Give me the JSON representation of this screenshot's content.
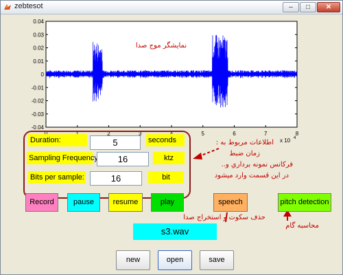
{
  "window": {
    "title": "zebtesot"
  },
  "plot": {
    "title": "نمایشگر موج صدا",
    "xticks": [
      "0",
      "1",
      "2",
      "3",
      "4",
      "5",
      "6",
      "7",
      "8"
    ],
    "yticks": [
      "0.04",
      "0.03",
      "0.02",
      "0.01",
      "0",
      "-0.01",
      "-0.02",
      "-0.03",
      "-0.04"
    ],
    "x_exponent": "x 10",
    "x_exponent_power": "4",
    "line_color": "#0000ff"
  },
  "chart_data": {
    "type": "line",
    "title": "نمایشگر موج صدا",
    "xlabel": "",
    "ylabel": "",
    "xlim": [
      0,
      80000
    ],
    "ylim": [
      -0.04,
      0.04
    ],
    "x_scale_note": "x 10^4",
    "grid": false,
    "series": [
      {
        "envelope_segments": [
          {
            "x": [
              0,
              15000
            ],
            "amp": 0.003
          },
          {
            "x": [
              15000,
              18000
            ],
            "amp": 0.025
          },
          {
            "x": [
              18000,
              53000
            ],
            "amp": 0.003
          },
          {
            "x": [
              53000,
              58000
            ],
            "amp": 0.03
          },
          {
            "x": [
              58000,
              80000
            ],
            "amp": 0.003
          }
        ]
      }
    ]
  },
  "params": {
    "duration": {
      "label": "Duration:",
      "value": "5",
      "unit": "seconds"
    },
    "sampling": {
      "label": "Sampling Frequency:",
      "value": "16",
      "unit": "ktz"
    },
    "bits": {
      "label": "Bits per sample:",
      "value": "16",
      "unit": "bit"
    }
  },
  "controls": {
    "record": {
      "label": "Record",
      "color": "#ff80c0"
    },
    "pause": {
      "label": "pause",
      "color": "#00ffff"
    },
    "resume": {
      "label": "resume",
      "color": "#ffff00"
    },
    "play": {
      "label": "play",
      "color": "#00e000"
    },
    "speech": {
      "label": "speech",
      "color": "#ffb060"
    },
    "pitch": {
      "label": "pitch detection",
      "color": "#80ff00"
    }
  },
  "filename": "s3.wav",
  "file_buttons": {
    "new": "new",
    "open": "open",
    "save": "save"
  },
  "annotations": {
    "info_line1": "اطلاعات مربوط به :",
    "info_line2": "زمان ضبط",
    "info_line3": "فرکانس نمونه برداري و..",
    "info_line4": "در اين قسمت وارد ميشود",
    "speech_note": "حذف سکوت و استخراج صدا",
    "pitch_note": "محاسبه گام"
  }
}
